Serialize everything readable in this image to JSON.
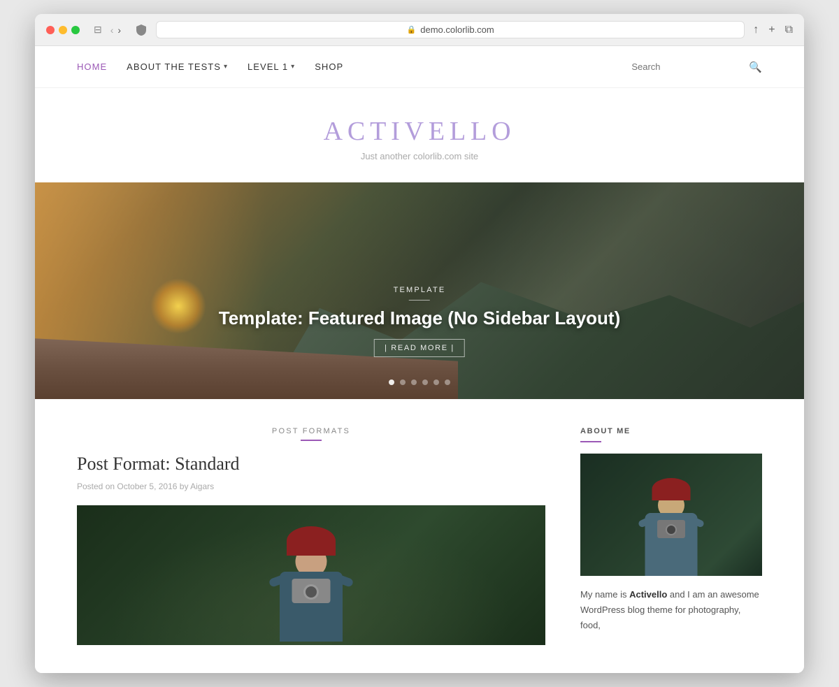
{
  "browser": {
    "url": "demo.colorlib.com",
    "reload_icon": "↻"
  },
  "nav": {
    "home_label": "HOME",
    "about_label": "AboUt THE TESTS",
    "level1_label": "LEVEL 1",
    "shop_label": "SHOP",
    "search_placeholder": "Search"
  },
  "site": {
    "title": "ACTIVELLO",
    "tagline": "Just another colorlib.com site"
  },
  "hero": {
    "category": "TEMPLATE",
    "title": "Template: Featured Image (No Sidebar Layout)",
    "read_more": "| READ MORE |",
    "dots": [
      {
        "active": true
      },
      {
        "active": false
      },
      {
        "active": false
      },
      {
        "active": false
      },
      {
        "active": false
      },
      {
        "active": false
      }
    ]
  },
  "post": {
    "category_label": "POST FORMATS",
    "title": "Post Format: Standard",
    "meta": "Posted on October 5, 2016  by Aigars"
  },
  "sidebar": {
    "about_title": "ABOUT ME",
    "about_text_1": "My name is ",
    "about_brand": "Activello",
    "about_text_2": " and I am an awesome WordPress blog theme for photography, food,"
  },
  "colors": {
    "accent": "#9b59b6",
    "nav_active": "#9b59b6"
  }
}
